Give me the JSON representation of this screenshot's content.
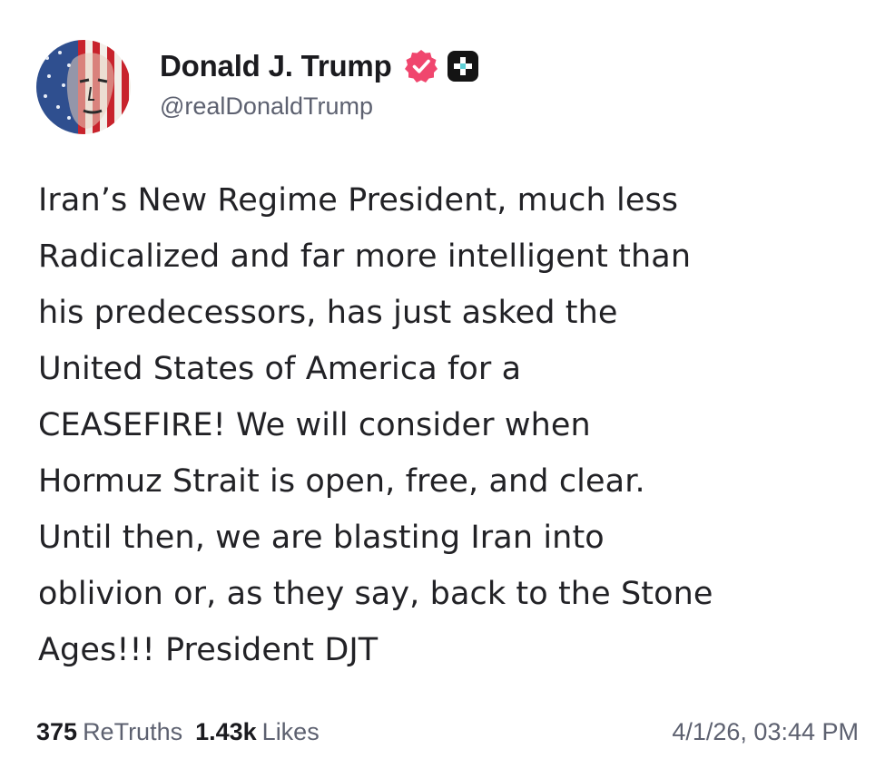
{
  "author": {
    "display_name": "Donald J. Trump",
    "handle": "@realDonaldTrump",
    "avatar_icon": "avatar-flag-portrait",
    "verified_icon": "verified-badge-icon",
    "verified_color": "#f0466e",
    "plus_icon": "plus-icon"
  },
  "post": {
    "lines": [
      "Iran’s New Regime President, much less",
      "Radicalized and far more intelligent than",
      "his predecessors, has just asked the",
      "United States of America for a",
      "CEASEFIRE! We will consider when",
      "Hormuz Strait is open, free, and clear.",
      "Until then, we are blasting Iran into",
      "oblivion or, as they say, back to the Stone",
      "Ages!!! President DJT"
    ]
  },
  "stats": {
    "retruths_count": "375",
    "retruths_label": "ReTruths",
    "likes_count": "1.43k",
    "likes_label": "Likes"
  },
  "timestamp": "4/1/26, 03:44 PM"
}
